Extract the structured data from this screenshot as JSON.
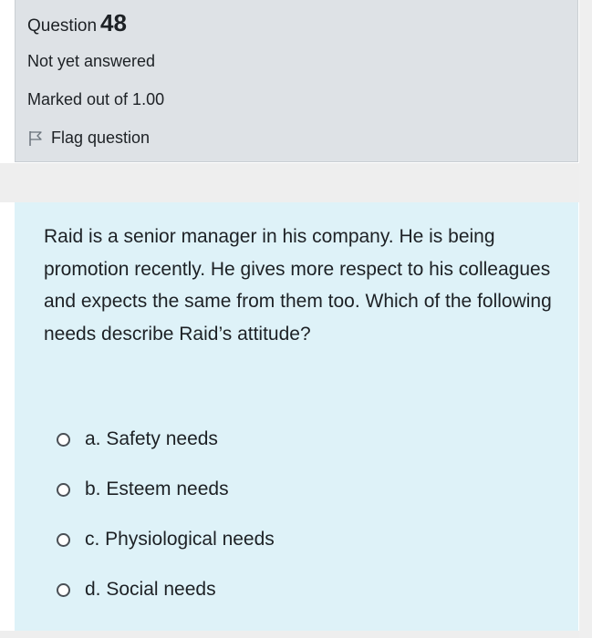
{
  "info": {
    "question_label": "Question",
    "question_number": "48",
    "state": "Not yet answered",
    "grade": "Marked out of 1.00",
    "flag_label": "Flag question",
    "flag_icon": "flag-outline-icon"
  },
  "question": {
    "text": "Raid is a senior manager in his company. He is being promotion recently. He gives more respect to his colleagues and expects the same from them too. Which of the following needs describe Raid’s attitude?"
  },
  "answers": [
    {
      "label": "a. Safety needs",
      "selected": false
    },
    {
      "label": "b. Esteem needs",
      "selected": false
    },
    {
      "label": "c. Physiological needs",
      "selected": false
    },
    {
      "label": "d. Social needs",
      "selected": false
    }
  ],
  "colors": {
    "info_bg": "#dee2e6",
    "content_bg": "#def2f8",
    "text": "#1d2125"
  }
}
